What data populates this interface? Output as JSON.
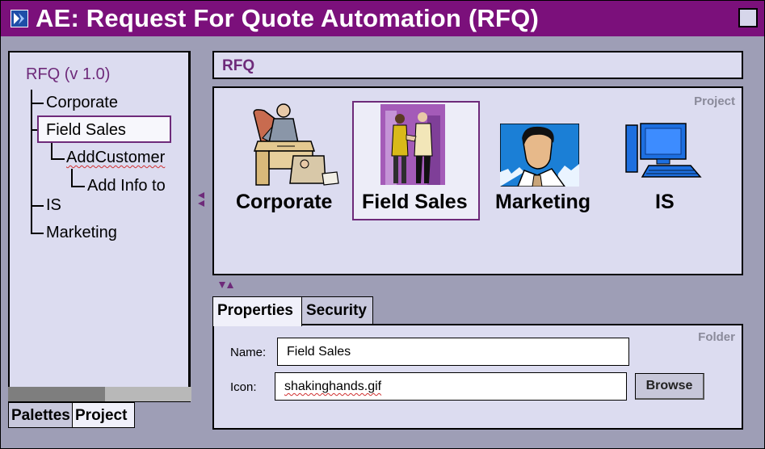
{
  "window": {
    "title": "AE: Request For Quote Automation (RFQ)",
    "accent_color": "#7b107b",
    "panel_color": "#dcdcf0",
    "label_color": "#6e2a7a"
  },
  "tree": {
    "root": "RFQ (v 1.0)",
    "items": [
      {
        "label": "Corporate",
        "level": 1
      },
      {
        "label": "Field Sales",
        "level": 1,
        "selected": true
      },
      {
        "label": "AddCustomer",
        "level": 2
      },
      {
        "label": "Add Info to",
        "level": 3
      },
      {
        "label": "IS",
        "level": 1
      },
      {
        "label": "Marketing",
        "level": 1
      }
    ]
  },
  "bottom_tabs": [
    "Palettes",
    "Project"
  ],
  "breadcrumb": "RFQ",
  "project_panel": {
    "caption": "Project",
    "items": [
      {
        "label": "Corporate",
        "icon": "office-worker-icon"
      },
      {
        "label": "Field Sales",
        "icon": "shaking-hands-icon",
        "selected": true
      },
      {
        "label": "Marketing",
        "icon": "businessman-portrait-icon"
      },
      {
        "label": "IS",
        "icon": "computer-icon"
      }
    ]
  },
  "tabs": [
    "Properties",
    "Security"
  ],
  "properties": {
    "caption": "Folder",
    "name_label": "Name:",
    "name_value": "Field Sales",
    "icon_label": "Icon:",
    "icon_value": "shakinghands.gif",
    "browse_label": "Browse"
  }
}
